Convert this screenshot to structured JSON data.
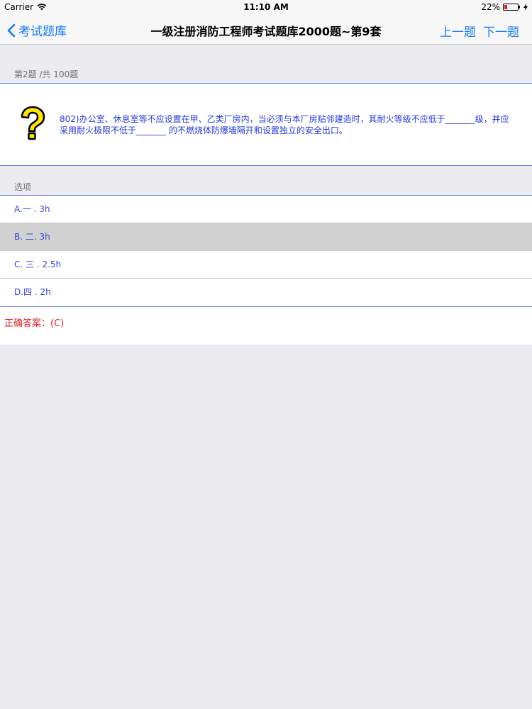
{
  "status_bar": {
    "carrier": "Carrier",
    "time": "11:10 AM",
    "battery_percent": "22%",
    "battery_level": 0.22,
    "battery_color": "#e02020"
  },
  "nav": {
    "back_label": "考试题库",
    "title": "一级注册消防工程师考试题库2000题~第9套",
    "prev_label": "上一题",
    "next_label": "下一题",
    "accent_color": "#1a7cf0"
  },
  "question": {
    "counter": "第2题 /共 100题",
    "text": "802)办公室、休息室等不应设置在甲、乙类厂房内，当必须与本厂房贴邻建造时，其耐火等级不应低于_______级，并应采用耐火极限不低于_______ 的不燃烧体防爆墙隔开和设置独立的安全出口。",
    "icon": "question-mark-icon"
  },
  "options_section": {
    "header": "选项",
    "items": [
      {
        "label": "A.一 . 3h",
        "selected": false
      },
      {
        "label": "B. 二. 3h",
        "selected": true
      },
      {
        "label": "C. 三 . 2.5h",
        "selected": false
      },
      {
        "label": "D.四 . 2h",
        "selected": false
      }
    ]
  },
  "answer": {
    "text": "正确答案：(C)",
    "color": "#e0202a"
  }
}
